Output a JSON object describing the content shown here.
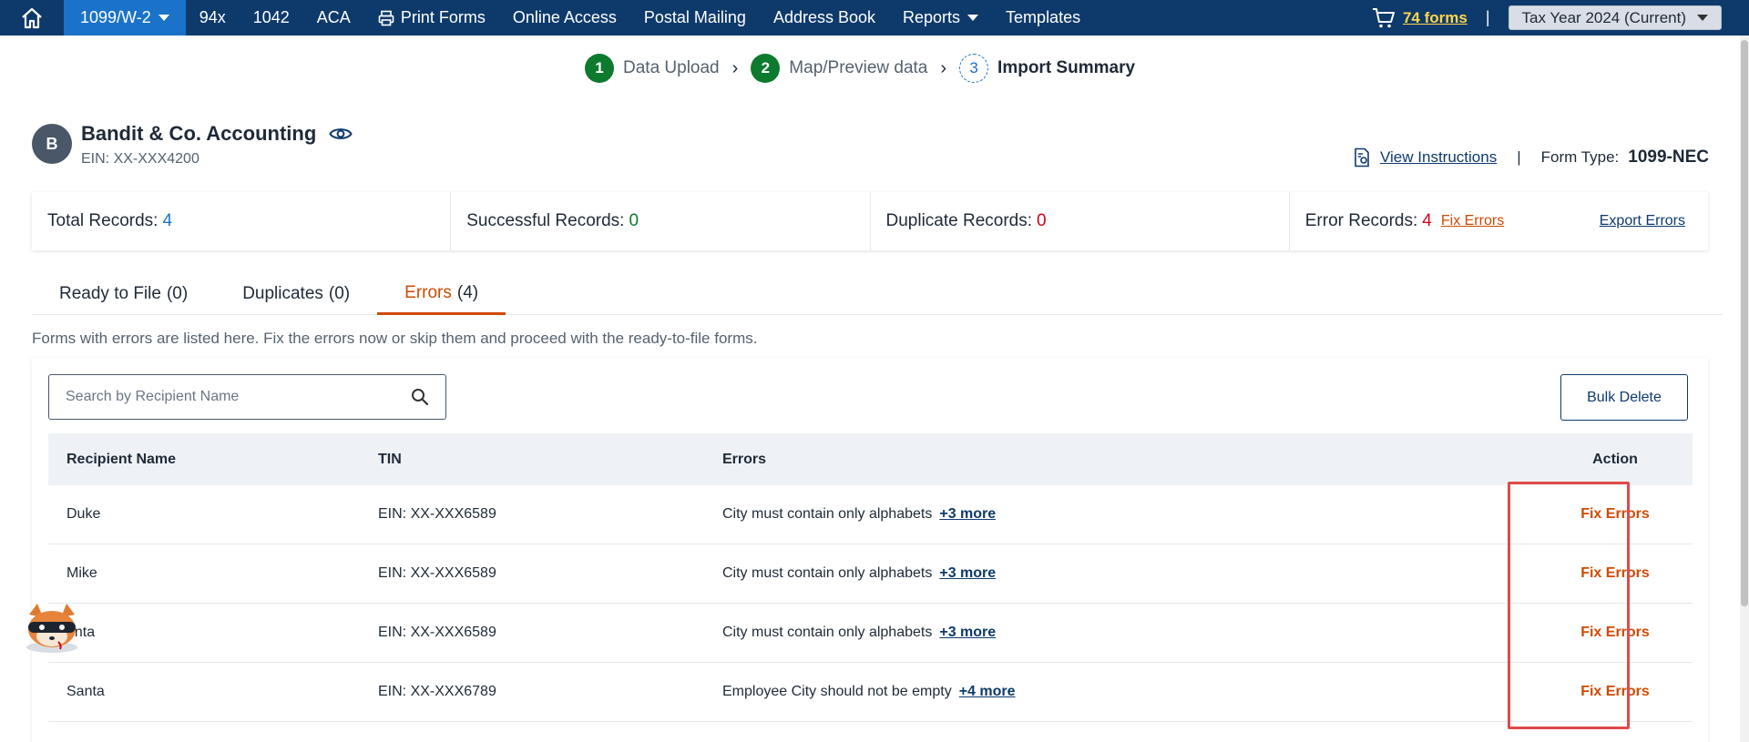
{
  "nav": {
    "items": [
      {
        "label": "1099/W-2",
        "active": true,
        "dropdown": true
      },
      {
        "label": "94x"
      },
      {
        "label": "1042"
      },
      {
        "label": "ACA"
      },
      {
        "label": "Print Forms",
        "icon": "printer-icon"
      },
      {
        "label": "Online Access"
      },
      {
        "label": "Postal Mailing"
      },
      {
        "label": "Address Book"
      },
      {
        "label": "Reports",
        "dropdown": true
      },
      {
        "label": "Templates"
      }
    ],
    "cart_label": "74 forms",
    "separator": "|",
    "tax_year": "Tax Year 2024 (Current)"
  },
  "stepper": {
    "steps": [
      {
        "num": "1",
        "label": "Data Upload"
      },
      {
        "num": "2",
        "label": "Map/Preview data"
      },
      {
        "num": "3",
        "label": "Import Summary"
      }
    ]
  },
  "company": {
    "initial": "B",
    "name": "Bandit & Co. Accounting",
    "ein": "EIN: XX-XXX4200",
    "view_instructions": "View Instructions",
    "separator": "|",
    "form_type_label": "Form Type:",
    "form_type_value": "1099-NEC"
  },
  "summary": {
    "total_label": "Total Records:",
    "total_value": "4",
    "success_label": "Successful Records:",
    "success_value": "0",
    "duplicate_label": "Duplicate Records:",
    "duplicate_value": "0",
    "error_label": "Error Records:",
    "error_value": "4",
    "fix_errors": "Fix Errors",
    "export_errors": "Export Errors"
  },
  "tabs": [
    {
      "label": "Ready to File",
      "count": "(0)"
    },
    {
      "label": "Duplicates",
      "count": "(0)"
    },
    {
      "label": "Errors",
      "count": "(4)",
      "active": true
    }
  ],
  "info_text": "Forms with errors are listed here. Fix the errors now or skip them and proceed with the ready-to-file forms.",
  "table": {
    "search_placeholder": "Search by Recipient Name",
    "bulk_delete": "Bulk Delete",
    "headers": {
      "name": "Recipient Name",
      "tin": "TIN",
      "errors": "Errors",
      "action": "Action"
    },
    "rows": [
      {
        "name": "Duke",
        "tin": "EIN: XX-XXX6589",
        "error": "City must contain only alphabets",
        "more": "+3 more",
        "action": "Fix Errors"
      },
      {
        "name": "Mike",
        "tin": "EIN: XX-XXX6589",
        "error": "City must contain only alphabets",
        "more": "+3 more",
        "action": "Fix Errors"
      },
      {
        "name": "unta",
        "tin": "EIN: XX-XXX6589",
        "error": "City must contain only alphabets",
        "more": "+3 more",
        "action": "Fix Errors"
      },
      {
        "name": "Santa",
        "tin": "EIN: XX-XXX6789",
        "error": "Employee City should not be empty",
        "more": "+4 more",
        "action": "Fix Errors"
      }
    ]
  },
  "colors": {
    "navy": "#0e3a6b",
    "accent_orange": "#d04a02",
    "success_green": "#0d7a2e",
    "error_red": "#d0021b",
    "highlight": "#e04a4a"
  }
}
